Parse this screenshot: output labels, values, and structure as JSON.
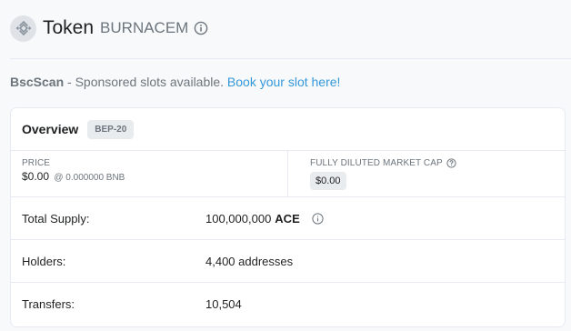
{
  "header": {
    "token_word": "Token",
    "token_name": "BURNACEM",
    "logo_icon": "bnb-logo-icon",
    "info_icon": "info-icon"
  },
  "sponsor": {
    "brand": "BscScan",
    "text": " - Sponsored slots available. ",
    "link": "Book your slot here!"
  },
  "overview": {
    "title": "Overview",
    "badge": "BEP-20",
    "price_label": "PRICE",
    "price_value": "$0.00",
    "price_bnb": "@ 0.000000 BNB",
    "mcap_label": "FULLY DILUTED MARKET CAP",
    "mcap_value": "$0.00",
    "rows": [
      {
        "key": "Total Supply:",
        "value": "100,000,000",
        "symbol": "ACE"
      },
      {
        "key": "Holders:",
        "value": "4,400 addresses"
      },
      {
        "key": "Transfers:",
        "value": "10,504"
      }
    ]
  },
  "colors": {
    "link": "#3498db",
    "muted": "#6c757d",
    "border": "#e7eaf3"
  }
}
